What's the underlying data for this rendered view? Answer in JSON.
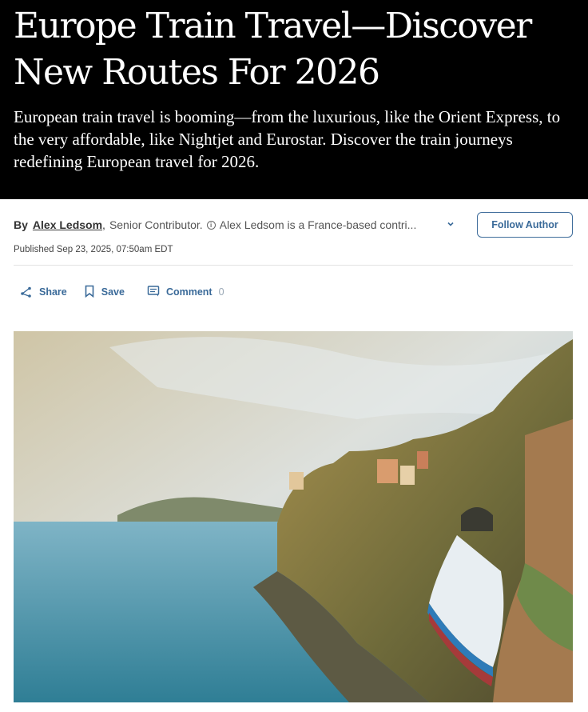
{
  "article": {
    "headline": "Europe Train Travel—Discover New Routes For 2026",
    "dek": "European train travel is booming—from the luxurious, like the Orient Express, to the very affordable, like Nightjet and Eurostar. Discover the train journeys redefining European travel for 2026."
  },
  "byline": {
    "by_label": "By",
    "author_name": "Alex Ledsom",
    "comma": ",",
    "role": "Senior Contributor.",
    "bio": "Alex Ledsom is a France-based contri...",
    "follow_label": "Follow Author"
  },
  "published": "Published Sep 23, 2025, 07:50am EDT",
  "actions": {
    "share_label": "Share",
    "save_label": "Save",
    "comment_label": "Comment",
    "comment_count": "0"
  },
  "colors": {
    "hero_background": "#000000",
    "accent": "#3a6a99"
  },
  "icons": [
    "info-icon",
    "chevron-down-icon",
    "share-icon",
    "bookmark-icon",
    "comment-icon"
  ]
}
